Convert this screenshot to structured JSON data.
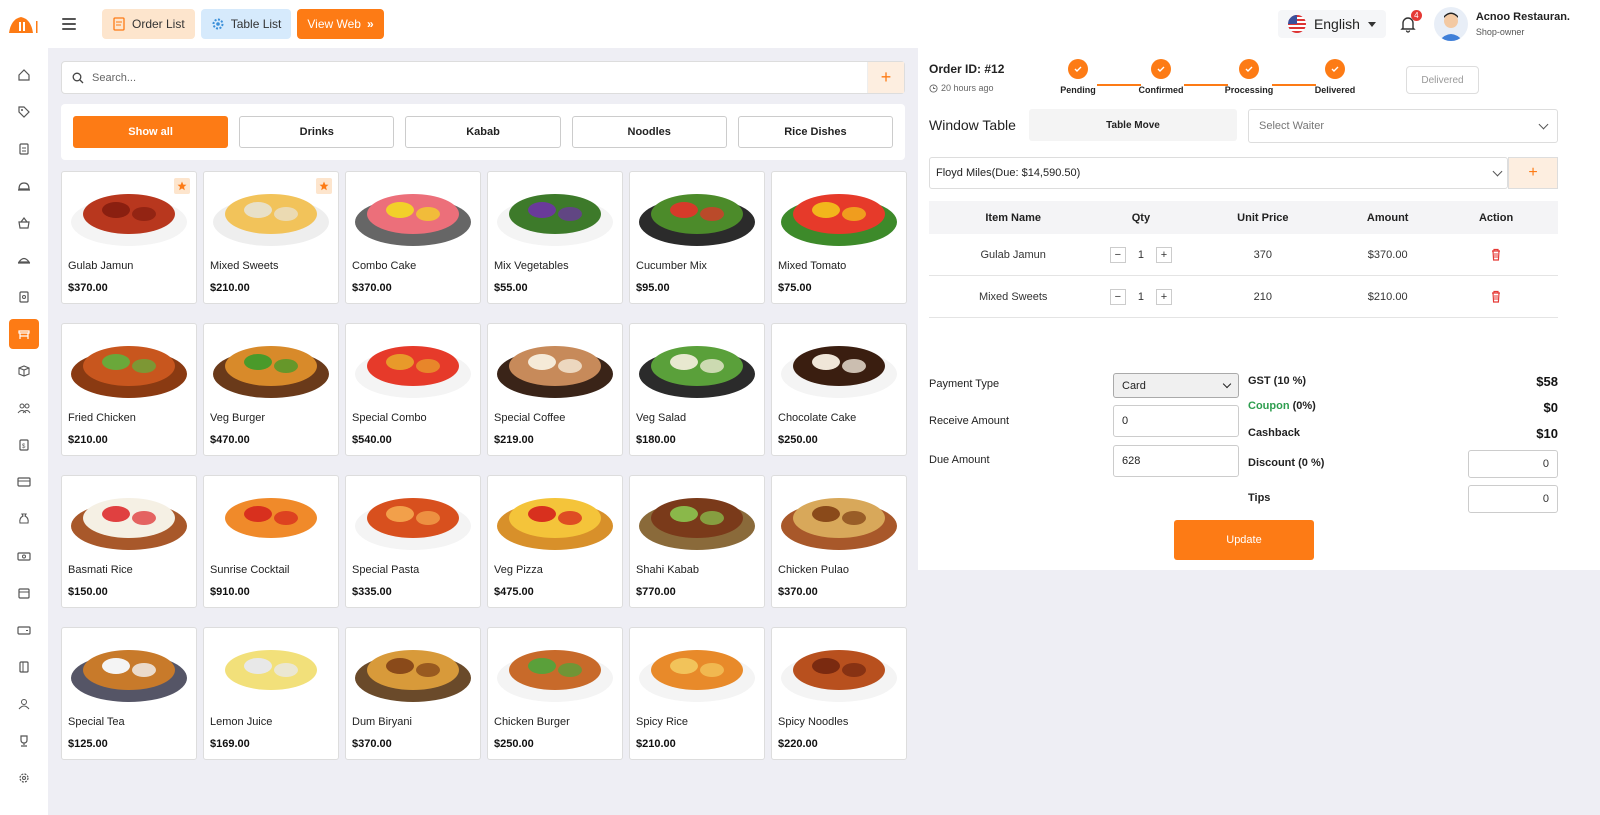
{
  "header": {
    "order_list": "Order List",
    "table_list": "Table List",
    "view_web": "View Web",
    "language": "English",
    "notification_count": "4",
    "user_name": "Acnoo Restauran.",
    "user_role": "Shop-owner"
  },
  "search": {
    "placeholder": "Search..."
  },
  "categories": [
    "Show all",
    "Drinks",
    "Kabab",
    "Noodles",
    "Rice Dishes"
  ],
  "products": [
    {
      "name": "Gulab Jamun",
      "price": "$370.00"
    },
    {
      "name": "Mixed Sweets",
      "price": "$210.00"
    },
    {
      "name": "Combo Cake",
      "price": "$370.00"
    },
    {
      "name": "Mix Vegetables",
      "price": "$55.00"
    },
    {
      "name": "Cucumber Mix",
      "price": "$95.00"
    },
    {
      "name": "Mixed Tomato",
      "price": "$75.00"
    },
    {
      "name": "Fried Chicken",
      "price": "$210.00"
    },
    {
      "name": "Veg Burger",
      "price": "$470.00"
    },
    {
      "name": "Special Combo",
      "price": "$540.00"
    },
    {
      "name": "Special Coffee",
      "price": "$219.00"
    },
    {
      "name": "Veg Salad",
      "price": "$180.00"
    },
    {
      "name": "Chocolate Cake",
      "price": "$250.00"
    },
    {
      "name": "Basmati Rice",
      "price": "$150.00"
    },
    {
      "name": "Sunrise Cocktail",
      "price": "$910.00"
    },
    {
      "name": "Special Pasta",
      "price": "$335.00"
    },
    {
      "name": "Veg Pizza",
      "price": "$475.00"
    },
    {
      "name": "Shahi Kabab",
      "price": "$770.00"
    },
    {
      "name": "Chicken Pulao",
      "price": "$370.00"
    },
    {
      "name": "Special Tea",
      "price": "$125.00"
    },
    {
      "name": "Lemon Juice",
      "price": "$169.00"
    },
    {
      "name": "Dum Biryani",
      "price": "$370.00"
    },
    {
      "name": "Chicken Burger",
      "price": "$250.00"
    },
    {
      "name": "Spicy Rice",
      "price": "$210.00"
    },
    {
      "name": "Spicy Noodles",
      "price": "$220.00"
    }
  ],
  "order": {
    "id": "Order ID: #12",
    "time": "20 hours ago",
    "steps": [
      "Pending",
      "Confirmed",
      "Processing",
      "Delivered"
    ],
    "status_button": "Delivered",
    "table_name": "Window Table",
    "table_move": "Table Move",
    "waiter_placeholder": "Select Waiter",
    "customer": "Floyd Miles(Due: $14,590.50)",
    "columns": [
      "Item Name",
      "Qty",
      "Unit Price",
      "Amount",
      "Action"
    ],
    "items": [
      {
        "name": "Gulab Jamun",
        "qty": "1",
        "unit": "370",
        "amount": "$370.00"
      },
      {
        "name": "Mixed Sweets",
        "qty": "1",
        "unit": "210",
        "amount": "$210.00"
      }
    ]
  },
  "payment": {
    "type_label": "Payment Type",
    "type_value": "Card",
    "receive_label": "Receive Amount",
    "receive_value": "0",
    "due_label": "Due Amount",
    "due_value": "628",
    "gst_label": "GST (10 %)",
    "gst_value": "$58",
    "coupon_label": "Coupon",
    "coupon_pct": " (0%)",
    "coupon_value": "$0",
    "cashback_label": "Cashback",
    "cashback_value": "$10",
    "discount_label": "Discount (0 %)",
    "discount_value": "0",
    "tips_label": "Tips",
    "tips_value": "0",
    "update": "Update"
  },
  "colors": {
    "accent": "#fd7b15",
    "coupon": "#2e9e4f",
    "delete": "#e53935"
  }
}
